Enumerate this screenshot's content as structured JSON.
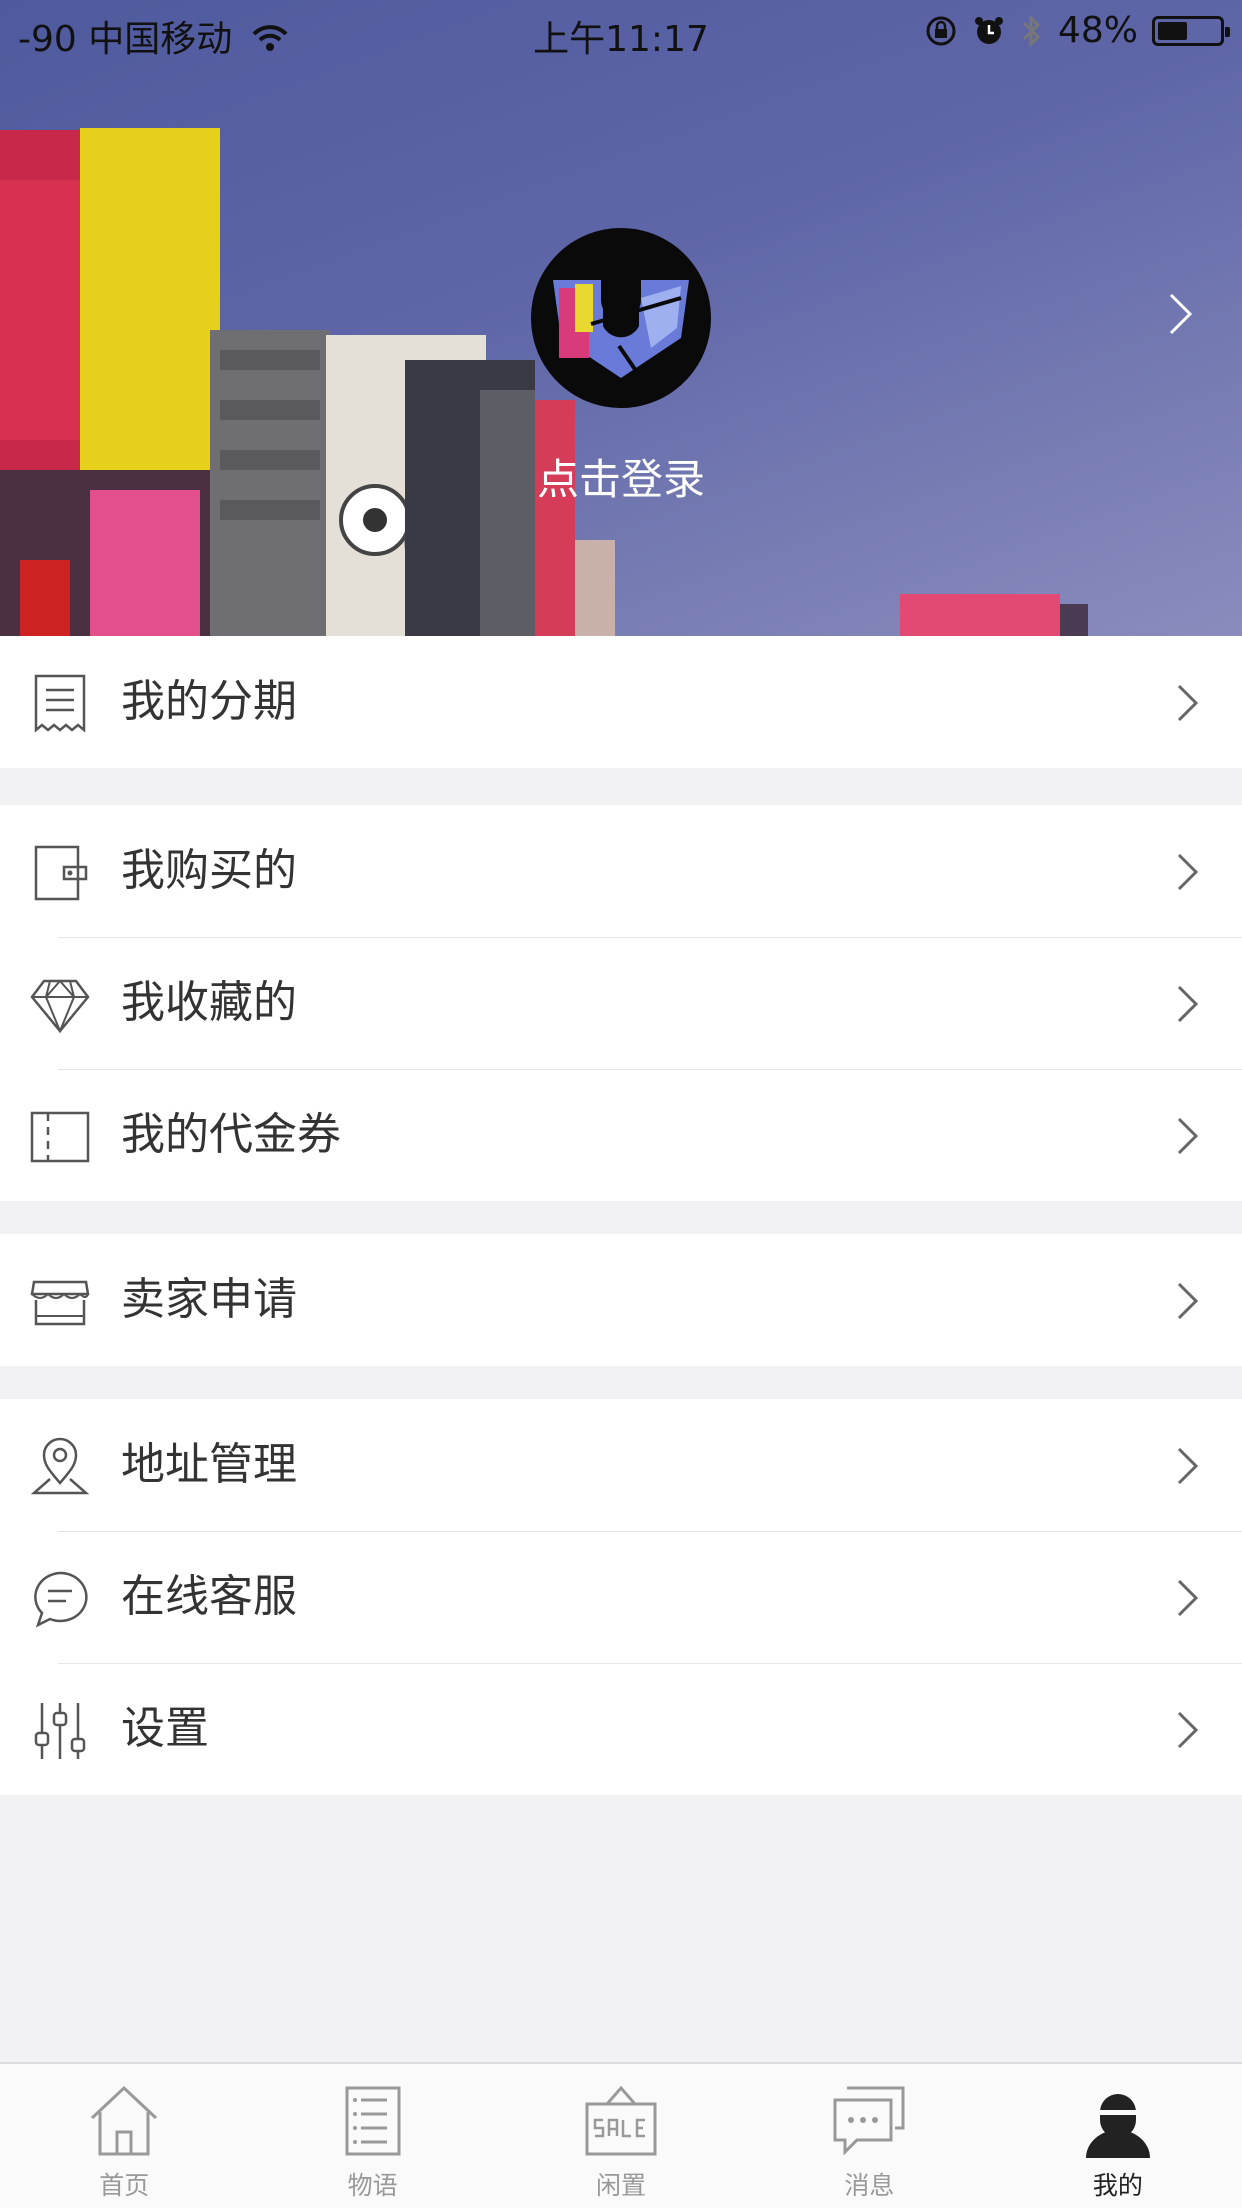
{
  "status_bar": {
    "signal": "-90",
    "carrier": "中国移动",
    "time": "上午11:17",
    "battery": "48%",
    "battery_level": 0.48
  },
  "header": {
    "login_text": "点击登录"
  },
  "menu_groups": [
    {
      "items": [
        {
          "label": "我的分期",
          "icon": "receipt-icon"
        }
      ]
    },
    {
      "items": [
        {
          "label": "我购买的",
          "icon": "wallet-icon"
        },
        {
          "label": "我收藏的",
          "icon": "diamond-icon"
        },
        {
          "label": "我的代金券",
          "icon": "ticket-icon"
        }
      ]
    },
    {
      "items": [
        {
          "label": "卖家申请",
          "icon": "store-icon"
        }
      ]
    },
    {
      "items": [
        {
          "label": "地址管理",
          "icon": "location-pin-icon"
        },
        {
          "label": "在线客服",
          "icon": "chat-bubble-icon"
        },
        {
          "label": "设置",
          "icon": "sliders-icon"
        }
      ]
    }
  ],
  "tabs": [
    {
      "label": "首页",
      "icon": "home-icon",
      "active": false
    },
    {
      "label": "物语",
      "icon": "document-list-icon",
      "active": false
    },
    {
      "label": "闲置",
      "icon": "sale-sign-icon",
      "active": false
    },
    {
      "label": "消息",
      "icon": "message-icon",
      "active": false
    },
    {
      "label": "我的",
      "icon": "user-icon",
      "active": true
    }
  ],
  "colors": {
    "header_bg": "#5c64a6",
    "page_bg": "#f2f2f4",
    "text": "#333333",
    "tab_inactive": "#999999",
    "tab_active": "#222222"
  }
}
